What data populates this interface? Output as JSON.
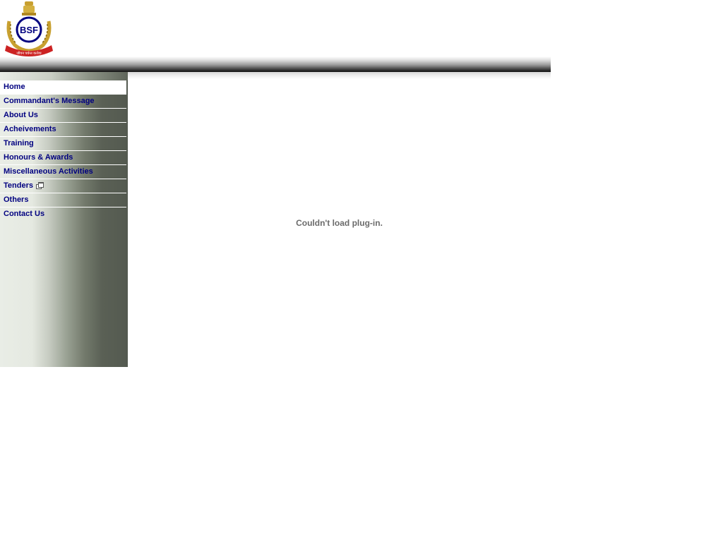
{
  "logo": {
    "text": "BSF",
    "motto": "जीवन पर्यन्त कर्तव्य",
    "colors": {
      "ring": "#000080",
      "wreath": "#c8a030",
      "banner": "#cc2222"
    }
  },
  "sidebar": {
    "items": [
      {
        "label": "Home",
        "active": true
      },
      {
        "label": "Commandant's Message"
      },
      {
        "label": "About Us"
      },
      {
        "label": "Acheivements"
      },
      {
        "label": "Training"
      },
      {
        "label": "Honours & Awards"
      },
      {
        "label": "Miscellaneous Activities"
      },
      {
        "label": "Tenders",
        "icon": "new-window-icon"
      },
      {
        "label": "Others"
      },
      {
        "label": "Contact Us"
      }
    ],
    "link_color": "#000080"
  },
  "main": {
    "plugin_message": "Couldn't load plug-in."
  }
}
